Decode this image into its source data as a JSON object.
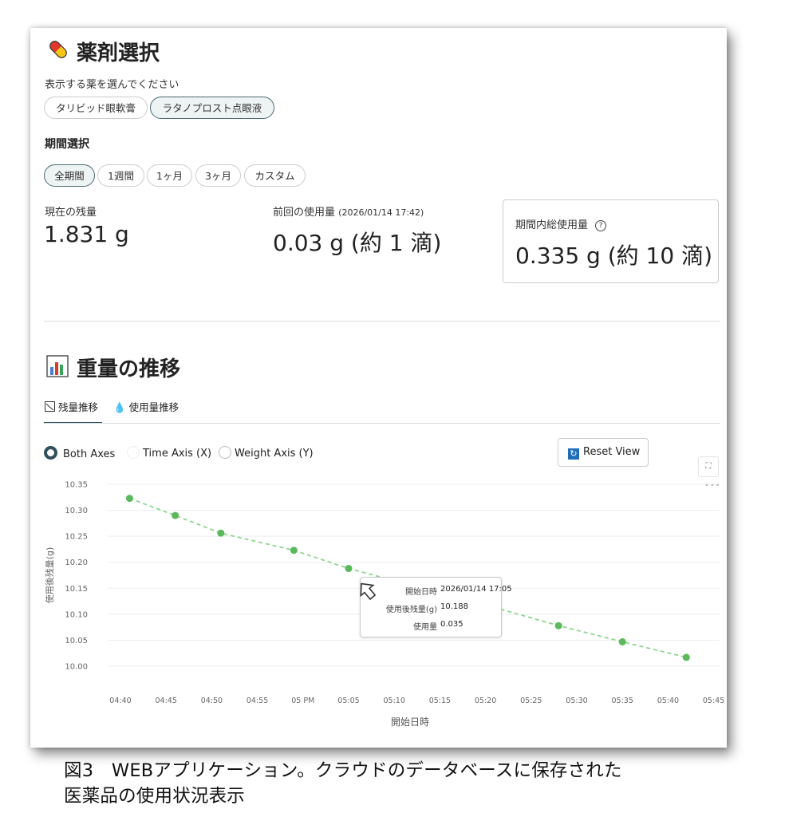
{
  "medicine_section": {
    "title": "薬剤選択",
    "instruction": "表示する薬を選んでください",
    "medicines": [
      {
        "label": "タリビッド眼軟膏",
        "selected": false
      },
      {
        "label": "ラタノプロスト点眼液",
        "selected": true
      }
    ]
  },
  "period_section": {
    "title": "期間選択",
    "options": [
      {
        "label": "全期間",
        "selected": true
      },
      {
        "label": "1週間",
        "selected": false
      },
      {
        "label": "1ヶ月",
        "selected": false
      },
      {
        "label": "3ヶ月",
        "selected": false
      },
      {
        "label": "カスタム",
        "selected": false
      }
    ]
  },
  "stats": {
    "remaining_label": "現在の残量",
    "remaining_value": "1.831 g",
    "last_use_label": "前回の使用量",
    "last_use_time": "(2026/01/14 17:42)",
    "last_use_value": "0.03 g (約 1 滴)",
    "period_total_label": "期間内総使用量",
    "period_total_value": "0.335 g (約 10 滴)"
  },
  "trend_section": {
    "title": "重量の推移",
    "tabs": [
      {
        "label": "残量推移",
        "active": true
      },
      {
        "label": "使用量推移",
        "active": false
      }
    ],
    "zoom_modes": [
      {
        "label": "Both Axes",
        "selected": true
      },
      {
        "label": "Time Axis (X)",
        "selected": false
      },
      {
        "label": "Weight Axis (Y)",
        "selected": false
      }
    ],
    "reset_label": "Reset View"
  },
  "tooltip": {
    "rows": [
      {
        "key": "開始日時",
        "value": "2026/01/14 17:05"
      },
      {
        "key": "使用後残量(g)",
        "value": "10.188"
      },
      {
        "key": "使用量",
        "value": "0.035"
      }
    ]
  },
  "chart_data": {
    "type": "line",
    "xlabel": "開始日時",
    "ylabel": "使用後残量(g)",
    "ylim": [
      10.0,
      10.35
    ],
    "y_ticks": [
      "10.35",
      "10.30",
      "10.25",
      "10.20",
      "10.15",
      "10.10",
      "10.05",
      "10.00"
    ],
    "x_ticks": [
      "04:40",
      "04:45",
      "04:50",
      "04:55",
      "05 PM",
      "05:05",
      "05:10",
      "05:15",
      "05:20",
      "05:25",
      "05:30",
      "05:35",
      "05:40",
      "05:45"
    ],
    "x_range_minutes": [
      0,
      65
    ],
    "line_style": "dashed",
    "color": "#5cb85c",
    "points": [
      {
        "x": "16:41",
        "y": 10.323
      },
      {
        "x": "16:46",
        "y": 10.29
      },
      {
        "x": "16:51",
        "y": 10.256
      },
      {
        "x": "16:59",
        "y": 10.223
      },
      {
        "x": "17:05",
        "y": 10.188
      },
      {
        "x": "17:20",
        "y": 10.118
      },
      {
        "x": "17:28",
        "y": 10.078
      },
      {
        "x": "17:35",
        "y": 10.047
      },
      {
        "x": "17:42",
        "y": 10.017
      }
    ],
    "grid": true
  },
  "caption": {
    "line1": "図3　WEBアプリケーション。クラウドのデータベースに保存された",
    "line2": "医薬品の使用状況表示"
  }
}
